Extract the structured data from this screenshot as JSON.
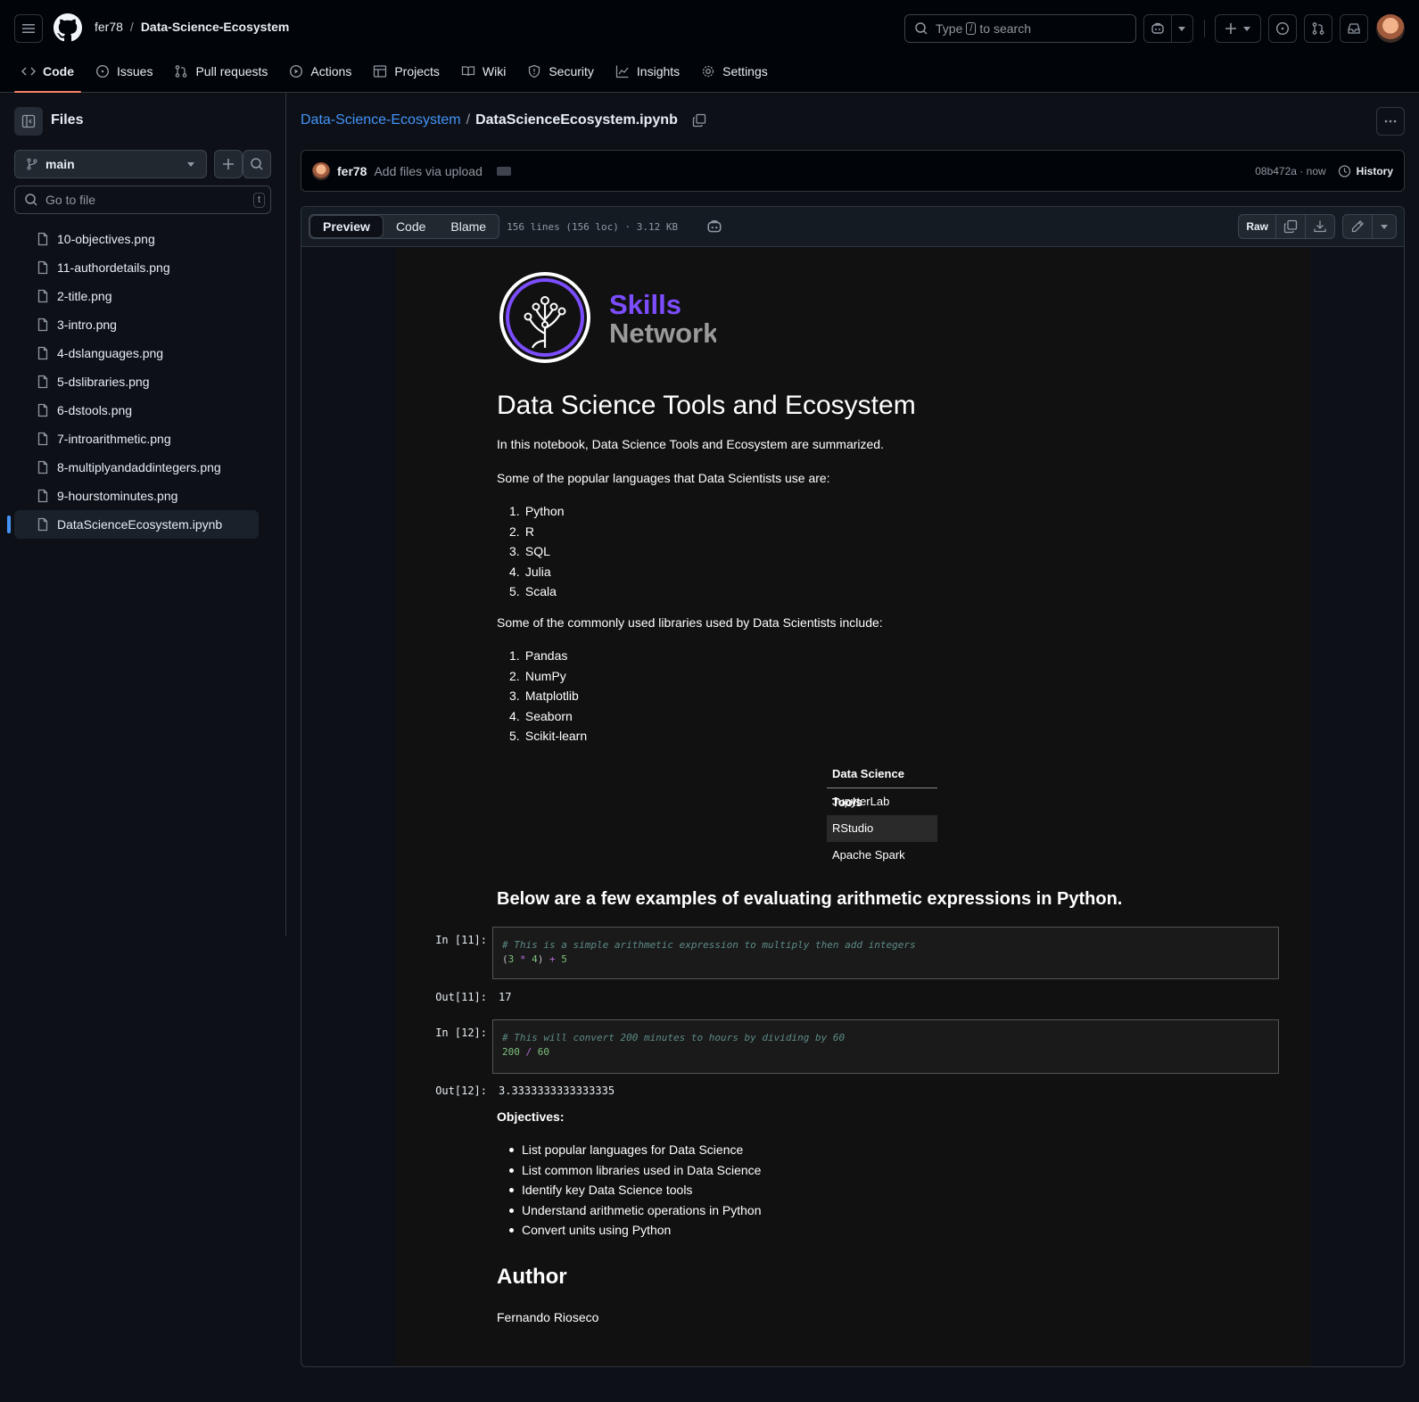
{
  "header": {
    "owner": "fer78",
    "separator": "/",
    "repo": "Data-Science-Ecosystem",
    "search_prefix": "Type",
    "search_key": "/",
    "search_suffix": "to search"
  },
  "repo_nav": {
    "tabs": [
      {
        "label": "Code",
        "icon": "code-icon"
      },
      {
        "label": "Issues",
        "icon": "issue-opened-icon"
      },
      {
        "label": "Pull requests",
        "icon": "git-pull-request-icon"
      },
      {
        "label": "Actions",
        "icon": "play-icon"
      },
      {
        "label": "Projects",
        "icon": "table-icon"
      },
      {
        "label": "Wiki",
        "icon": "book-icon"
      },
      {
        "label": "Security",
        "icon": "shield-icon"
      },
      {
        "label": "Insights",
        "icon": "graph-icon"
      },
      {
        "label": "Settings",
        "icon": "gear-icon"
      }
    ]
  },
  "sidebar": {
    "title": "Files",
    "branch": "main",
    "goto_placeholder": "Go to file",
    "goto_key": "t",
    "files": [
      "10-objectives.png",
      "11-authordetails.png",
      "2-title.png",
      "3-intro.png",
      "4-dslanguages.png",
      "5-dslibraries.png",
      "6-dstools.png",
      "7-introarithmetic.png",
      "8-multiplyandaddintegers.png",
      "9-hourstominutes.png",
      "DataScienceEcosystem.ipynb"
    ],
    "selected": "DataScienceEcosystem.ipynb"
  },
  "path": {
    "repo_link": "Data-Science-Ecosystem",
    "separator": "/",
    "file": "DataScienceEcosystem.ipynb"
  },
  "commit": {
    "user": "fer78",
    "message": "Add files via upload",
    "sha": "08b472a",
    "dot": "·",
    "time": "now",
    "history_label": "History"
  },
  "file_header": {
    "views": [
      "Preview",
      "Code",
      "Blame"
    ],
    "active_view": "Preview",
    "info": "156 lines (156 loc) · 3.12 KB",
    "raw_label": "Raw"
  },
  "notebook": {
    "logo_line1": "Skills",
    "logo_line2": "Network",
    "title": "Data Science Tools and Ecosystem",
    "intro": "In this notebook, Data Science Tools and Ecosystem are summarized.",
    "languages_intro": "Some of the popular languages that Data Scientists use are:",
    "languages": [
      "Python",
      "R",
      "SQL",
      "Julia",
      "Scala"
    ],
    "libraries_intro": "Some of the commonly used libraries used by Data Scientists include:",
    "libraries": [
      "Pandas",
      "NumPy",
      "Matplotlib",
      "Seaborn",
      "Scikit-learn"
    ],
    "tools_header": "Data Science Tools",
    "tools": [
      "JupyterLab",
      "RStudio",
      "Apache Spark"
    ],
    "arith_heading": "Below are a few examples of evaluating arithmetic expressions in Python.",
    "cell1": {
      "in_prompt": "In [11]:",
      "comment": "# This is a simple arithmetic expression to multiply then add integers",
      "out_prompt": "Out[11]:",
      "output": "17"
    },
    "cell2": {
      "in_prompt": "In [12]:",
      "comment": "# This will convert 200 minutes to hours by dividing by 60",
      "out_prompt": "Out[12]:",
      "output": "3.3333333333333335"
    },
    "objectives_label": "Objectives:",
    "objectives": [
      "List popular languages for Data Science",
      "List common libraries used in Data Science",
      "Identify key Data Science tools",
      "Understand arithmetic operations in Python",
      "Convert units using Python"
    ],
    "author_heading": "Author",
    "author_name": "Fernando Rioseco"
  },
  "colors": {
    "accent_link": "#4493f8",
    "active_tab_underline": "#f78166",
    "logo_purple": "#7c4dff"
  }
}
